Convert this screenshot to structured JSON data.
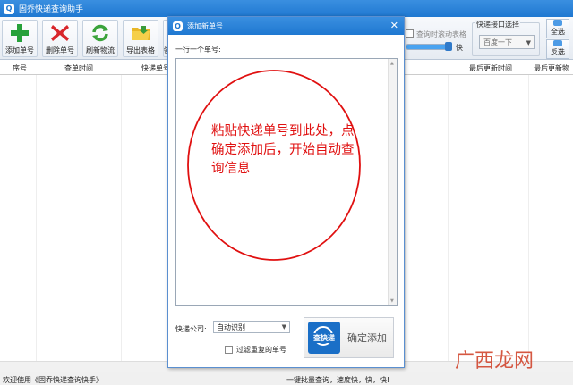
{
  "app": {
    "title": "固乔快递查询助手",
    "icon_text": "Q"
  },
  "toolbar": {
    "buttons": [
      {
        "label": "添加单号",
        "icon": "plus-icon",
        "color": "#27a13a"
      },
      {
        "label": "删除单号",
        "icon": "delete-x-icon",
        "color": "#d8262b"
      },
      {
        "label": "刷新物流",
        "icon": "refresh-icon",
        "color": "#3ba33b"
      },
      {
        "label": "导出表格",
        "icon": "folder-icon",
        "color": "#e8b627"
      },
      {
        "label": "指",
        "icon": "partial-icon",
        "color": "#6f8fb3"
      }
    ],
    "scroll_label": "查询时滚动表格",
    "speed_label": "快",
    "interface_group": "快递接口选择",
    "interface_value": "百度一下",
    "select_all": "全选",
    "invert": "反选"
  },
  "table": {
    "columns": [
      "序号",
      "查单时间",
      "快递单号",
      "最后更新时间",
      "最后更新物"
    ]
  },
  "status": {
    "left": "欢迎使用《固乔快递查询快手》",
    "right": "一键批量查询，速度快，快，快!"
  },
  "dialog": {
    "title": "添加新单号",
    "close": "✕",
    "instruction": "一行一个单号:",
    "annotation": "粘贴快递单号到此处，点确定添加后，开始自动查询信息",
    "company_label": "快递公司:",
    "company_value": "自动识别",
    "dedupe_label": "过滤重复的单号",
    "confirm_logo": "查快递",
    "confirm_label": "确定添加"
  },
  "watermark": "广西龙网"
}
